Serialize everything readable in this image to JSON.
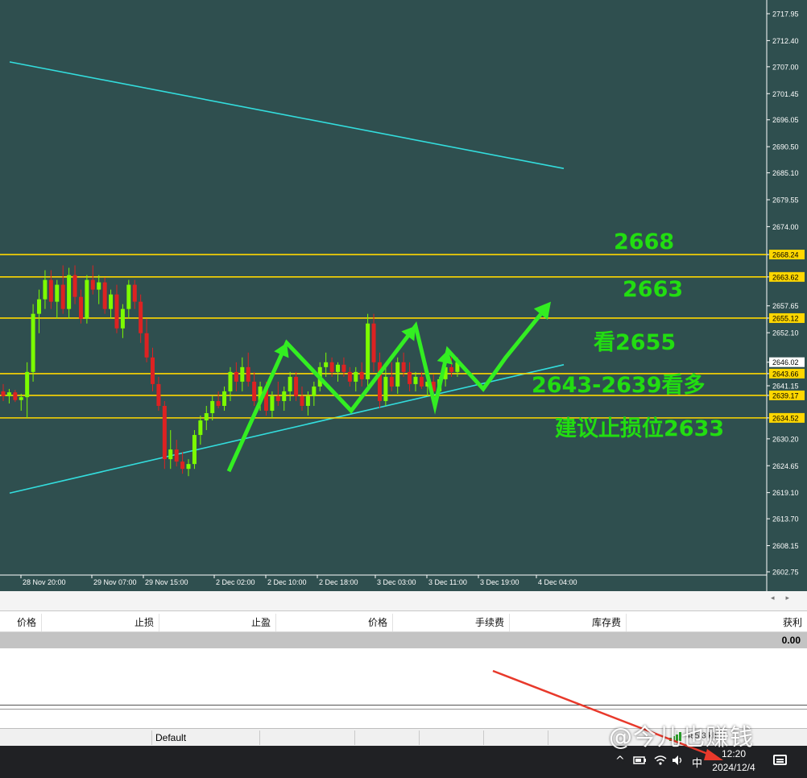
{
  "colors": {
    "chart_bg": "#2f4f4f",
    "bull": "#7cfc00",
    "bear": "#dd2222",
    "level_line": "#ffd700",
    "trend_line": "#33dddd",
    "arrow": "#33ee22",
    "annotation": "#22dd11",
    "axis_text": "#ffffff"
  },
  "chart_data": {
    "type": "candlestick",
    "y_axis_ticks": [
      "2717.95",
      "2712.40",
      "2707.00",
      "2701.45",
      "2696.05",
      "2690.50",
      "2685.10",
      "2679.55",
      "2674.00",
      "2668.24",
      "2663.62",
      "2657.65",
      "2655.12",
      "2652.10",
      "2646.02",
      "2643.66",
      "2641.15",
      "2639.17",
      "2634.52",
      "2630.20",
      "2624.65",
      "2619.10",
      "2613.70",
      "2608.15",
      "2602.75"
    ],
    "ylim": [
      2602.75,
      2717.95
    ],
    "x_axis_ticks": [
      "28 Nov 20:00",
      "29 Nov 07:00",
      "29 Nov 15:00",
      "2 Dec 02:00",
      "2 Dec 10:00",
      "2 Dec 18:00",
      "3 Dec 03:00",
      "3 Dec 11:00",
      "3 Dec 19:00",
      "4 Dec 04:00"
    ],
    "horizontal_levels": [
      {
        "value": 2668.24,
        "label": "2668.24"
      },
      {
        "value": 2663.62,
        "label": "2663.62"
      },
      {
        "value": 2655.12,
        "label": "2655.12"
      },
      {
        "value": 2643.66,
        "label": "2643.66"
      },
      {
        "value": 2639.17,
        "label": "2639.17"
      },
      {
        "value": 2634.52,
        "label": "2634.52"
      }
    ],
    "current_price": {
      "value": 2646.02,
      "label": "2646.02"
    },
    "trend_lines": [
      {
        "from": [
          "28 Nov 18:00",
          2708.0
        ],
        "to": [
          "4 Dec 08:00",
          2686.0
        ]
      },
      {
        "from": [
          "28 Nov 18:00",
          2619.0
        ],
        "to": [
          "4 Dec 08:00",
          2645.5
        ]
      }
    ],
    "candles": [
      {
        "o": 2640.0,
        "h": 2641.5,
        "l": 2638.0,
        "c": 2639.0
      },
      {
        "o": 2639.0,
        "h": 2640.5,
        "l": 2637.5,
        "c": 2639.8
      },
      {
        "o": 2639.8,
        "h": 2640.3,
        "l": 2637.8,
        "c": 2638.2
      },
      {
        "o": 2638.2,
        "h": 2639.5,
        "l": 2636.0,
        "c": 2638.8
      },
      {
        "o": 2638.8,
        "h": 2646.0,
        "l": 2634.5,
        "c": 2644.0
      },
      {
        "o": 2644.0,
        "h": 2658.0,
        "l": 2642.0,
        "c": 2656.0
      },
      {
        "o": 2656.0,
        "h": 2661.0,
        "l": 2652.0,
        "c": 2659.0
      },
      {
        "o": 2659.0,
        "h": 2665.0,
        "l": 2657.0,
        "c": 2663.0
      },
      {
        "o": 2663.0,
        "h": 2665.0,
        "l": 2657.0,
        "c": 2658.5
      },
      {
        "o": 2658.5,
        "h": 2663.0,
        "l": 2655.0,
        "c": 2662.0
      },
      {
        "o": 2662.0,
        "h": 2666.0,
        "l": 2656.0,
        "c": 2657.0
      },
      {
        "o": 2657.0,
        "h": 2665.5,
        "l": 2655.0,
        "c": 2664.0
      },
      {
        "o": 2664.0,
        "h": 2666.0,
        "l": 2658.0,
        "c": 2659.5
      },
      {
        "o": 2659.5,
        "h": 2661.0,
        "l": 2654.0,
        "c": 2655.0
      },
      {
        "o": 2655.0,
        "h": 2664.0,
        "l": 2654.0,
        "c": 2663.0
      },
      {
        "o": 2663.0,
        "h": 2666.0,
        "l": 2660.0,
        "c": 2661.0
      },
      {
        "o": 2661.0,
        "h": 2664.0,
        "l": 2658.0,
        "c": 2662.5
      },
      {
        "o": 2662.5,
        "h": 2663.5,
        "l": 2656.0,
        "c": 2657.0
      },
      {
        "o": 2657.0,
        "h": 2661.0,
        "l": 2655.0,
        "c": 2660.0
      },
      {
        "o": 2660.0,
        "h": 2662.0,
        "l": 2652.0,
        "c": 2653.0
      },
      {
        "o": 2653.0,
        "h": 2658.0,
        "l": 2651.0,
        "c": 2657.0
      },
      {
        "o": 2657.0,
        "h": 2663.0,
        "l": 2655.0,
        "c": 2662.0
      },
      {
        "o": 2662.0,
        "h": 2663.0,
        "l": 2657.0,
        "c": 2658.5
      },
      {
        "o": 2658.5,
        "h": 2660.0,
        "l": 2650.0,
        "c": 2652.0
      },
      {
        "o": 2652.0,
        "h": 2655.0,
        "l": 2646.0,
        "c": 2647.0
      },
      {
        "o": 2647.0,
        "h": 2649.0,
        "l": 2640.0,
        "c": 2641.5
      },
      {
        "o": 2641.5,
        "h": 2643.0,
        "l": 2636.0,
        "c": 2637.0
      },
      {
        "o": 2637.0,
        "h": 2638.0,
        "l": 2624.0,
        "c": 2626.0
      },
      {
        "o": 2626.0,
        "h": 2632.0,
        "l": 2624.0,
        "c": 2628.0
      },
      {
        "o": 2628.0,
        "h": 2630.0,
        "l": 2624.5,
        "c": 2625.5
      },
      {
        "o": 2625.5,
        "h": 2627.5,
        "l": 2623.0,
        "c": 2624.0
      },
      {
        "o": 2624.0,
        "h": 2626.0,
        "l": 2622.5,
        "c": 2625.0
      },
      {
        "o": 2625.0,
        "h": 2632.0,
        "l": 2624.0,
        "c": 2631.0
      },
      {
        "o": 2631.0,
        "h": 2635.0,
        "l": 2629.0,
        "c": 2634.0
      },
      {
        "o": 2634.0,
        "h": 2637.0,
        "l": 2632.0,
        "c": 2635.5
      },
      {
        "o": 2635.5,
        "h": 2639.0,
        "l": 2634.0,
        "c": 2638.0
      },
      {
        "o": 2638.0,
        "h": 2640.0,
        "l": 2636.5,
        "c": 2637.0
      },
      {
        "o": 2637.0,
        "h": 2641.0,
        "l": 2636.0,
        "c": 2640.0
      },
      {
        "o": 2640.0,
        "h": 2645.0,
        "l": 2638.0,
        "c": 2644.0
      },
      {
        "o": 2644.0,
        "h": 2646.0,
        "l": 2640.0,
        "c": 2642.0
      },
      {
        "o": 2642.0,
        "h": 2647.0,
        "l": 2640.0,
        "c": 2645.0
      },
      {
        "o": 2645.0,
        "h": 2648.0,
        "l": 2641.0,
        "c": 2642.0
      },
      {
        "o": 2642.0,
        "h": 2644.0,
        "l": 2637.0,
        "c": 2638.0
      },
      {
        "o": 2638.0,
        "h": 2642.0,
        "l": 2636.0,
        "c": 2641.0
      },
      {
        "o": 2641.0,
        "h": 2642.0,
        "l": 2635.0,
        "c": 2636.0
      },
      {
        "o": 2636.0,
        "h": 2640.0,
        "l": 2634.5,
        "c": 2639.0
      },
      {
        "o": 2639.0,
        "h": 2642.0,
        "l": 2637.0,
        "c": 2638.0
      },
      {
        "o": 2638.0,
        "h": 2641.0,
        "l": 2636.0,
        "c": 2640.0
      },
      {
        "o": 2640.0,
        "h": 2644.0,
        "l": 2638.0,
        "c": 2643.0
      },
      {
        "o": 2643.0,
        "h": 2644.0,
        "l": 2638.0,
        "c": 2639.0
      },
      {
        "o": 2639.0,
        "h": 2641.0,
        "l": 2636.0,
        "c": 2637.0
      },
      {
        "o": 2637.0,
        "h": 2640.0,
        "l": 2635.0,
        "c": 2639.0
      },
      {
        "o": 2639.0,
        "h": 2642.0,
        "l": 2637.0,
        "c": 2641.0
      },
      {
        "o": 2641.0,
        "h": 2646.0,
        "l": 2640.0,
        "c": 2645.0
      },
      {
        "o": 2645.0,
        "h": 2648.0,
        "l": 2643.0,
        "c": 2646.0
      },
      {
        "o": 2646.0,
        "h": 2647.0,
        "l": 2643.0,
        "c": 2644.0
      },
      {
        "o": 2644.0,
        "h": 2646.0,
        "l": 2642.0,
        "c": 2645.5
      },
      {
        "o": 2645.5,
        "h": 2647.0,
        "l": 2643.0,
        "c": 2644.0
      },
      {
        "o": 2644.0,
        "h": 2645.0,
        "l": 2641.0,
        "c": 2642.0
      },
      {
        "o": 2642.0,
        "h": 2645.0,
        "l": 2640.0,
        "c": 2644.0
      },
      {
        "o": 2644.0,
        "h": 2646.0,
        "l": 2641.0,
        "c": 2642.5
      },
      {
        "o": 2642.5,
        "h": 2656.0,
        "l": 2641.0,
        "c": 2654.0
      },
      {
        "o": 2654.0,
        "h": 2656.0,
        "l": 2644.0,
        "c": 2646.0
      },
      {
        "o": 2646.0,
        "h": 2648.0,
        "l": 2636.5,
        "c": 2638.0
      },
      {
        "o": 2638.0,
        "h": 2645.0,
        "l": 2637.0,
        "c": 2643.0
      },
      {
        "o": 2643.0,
        "h": 2646.0,
        "l": 2640.0,
        "c": 2641.0
      },
      {
        "o": 2641.0,
        "h": 2647.0,
        "l": 2639.5,
        "c": 2646.0
      },
      {
        "o": 2646.0,
        "h": 2648.0,
        "l": 2643.0,
        "c": 2644.0
      },
      {
        "o": 2644.0,
        "h": 2646.0,
        "l": 2640.0,
        "c": 2641.5
      },
      {
        "o": 2641.5,
        "h": 2644.0,
        "l": 2640.0,
        "c": 2643.0
      },
      {
        "o": 2643.0,
        "h": 2644.0,
        "l": 2640.5,
        "c": 2641.0
      },
      {
        "o": 2641.0,
        "h": 2643.0,
        "l": 2639.0,
        "c": 2642.0
      },
      {
        "o": 2642.0,
        "h": 2643.5,
        "l": 2638.0,
        "c": 2640.0
      },
      {
        "o": 2640.0,
        "h": 2643.0,
        "l": 2639.0,
        "c": 2642.5
      },
      {
        "o": 2642.5,
        "h": 2646.0,
        "l": 2641.0,
        "c": 2645.0
      },
      {
        "o": 2645.0,
        "h": 2648.0,
        "l": 2643.0,
        "c": 2644.0
      },
      {
        "o": 2644.0,
        "h": 2647.0,
        "l": 2643.0,
        "c": 2646.0
      }
    ],
    "forecast_path": [
      [
        "2 Dec 04:00",
        2623.5
      ],
      [
        "2 Dec 13:00",
        2650.0
      ],
      [
        "2 Dec 23:00",
        2636.0
      ],
      [
        "3 Dec 09:00",
        2653.5
      ],
      [
        "3 Dec 12:00",
        2637.0
      ],
      [
        "3 Dec 14:00",
        2648.5
      ],
      [
        "3 Dec 19:30",
        2640.5
      ],
      [
        "3 Dec 23:00",
        2647.0
      ],
      [
        "4 Dec 06:00",
        2658.5
      ]
    ]
  },
  "annotations": [
    {
      "id": "t1",
      "text": "2668"
    },
    {
      "id": "t2",
      "text": "2663"
    },
    {
      "id": "t3",
      "text": "看2655"
    },
    {
      "id": "t4",
      "text": "2643-2639看多"
    },
    {
      "id": "t5",
      "text": "建议止损位2633"
    }
  ],
  "terminal": {
    "columns": [
      "价格",
      "止损",
      "止盈",
      "价格",
      "手续费",
      "库存费",
      "获利"
    ],
    "balance_value": "0.00",
    "scroll_left": "◂",
    "scroll_right": "▸"
  },
  "status_bar": {
    "profile": "Default",
    "connection": "485/3 kb"
  },
  "taskbar": {
    "tray_chevron": "^",
    "ime": "中",
    "time": "12:20",
    "date": "2024/12/4"
  },
  "watermark": "@今儿也赚钱"
}
